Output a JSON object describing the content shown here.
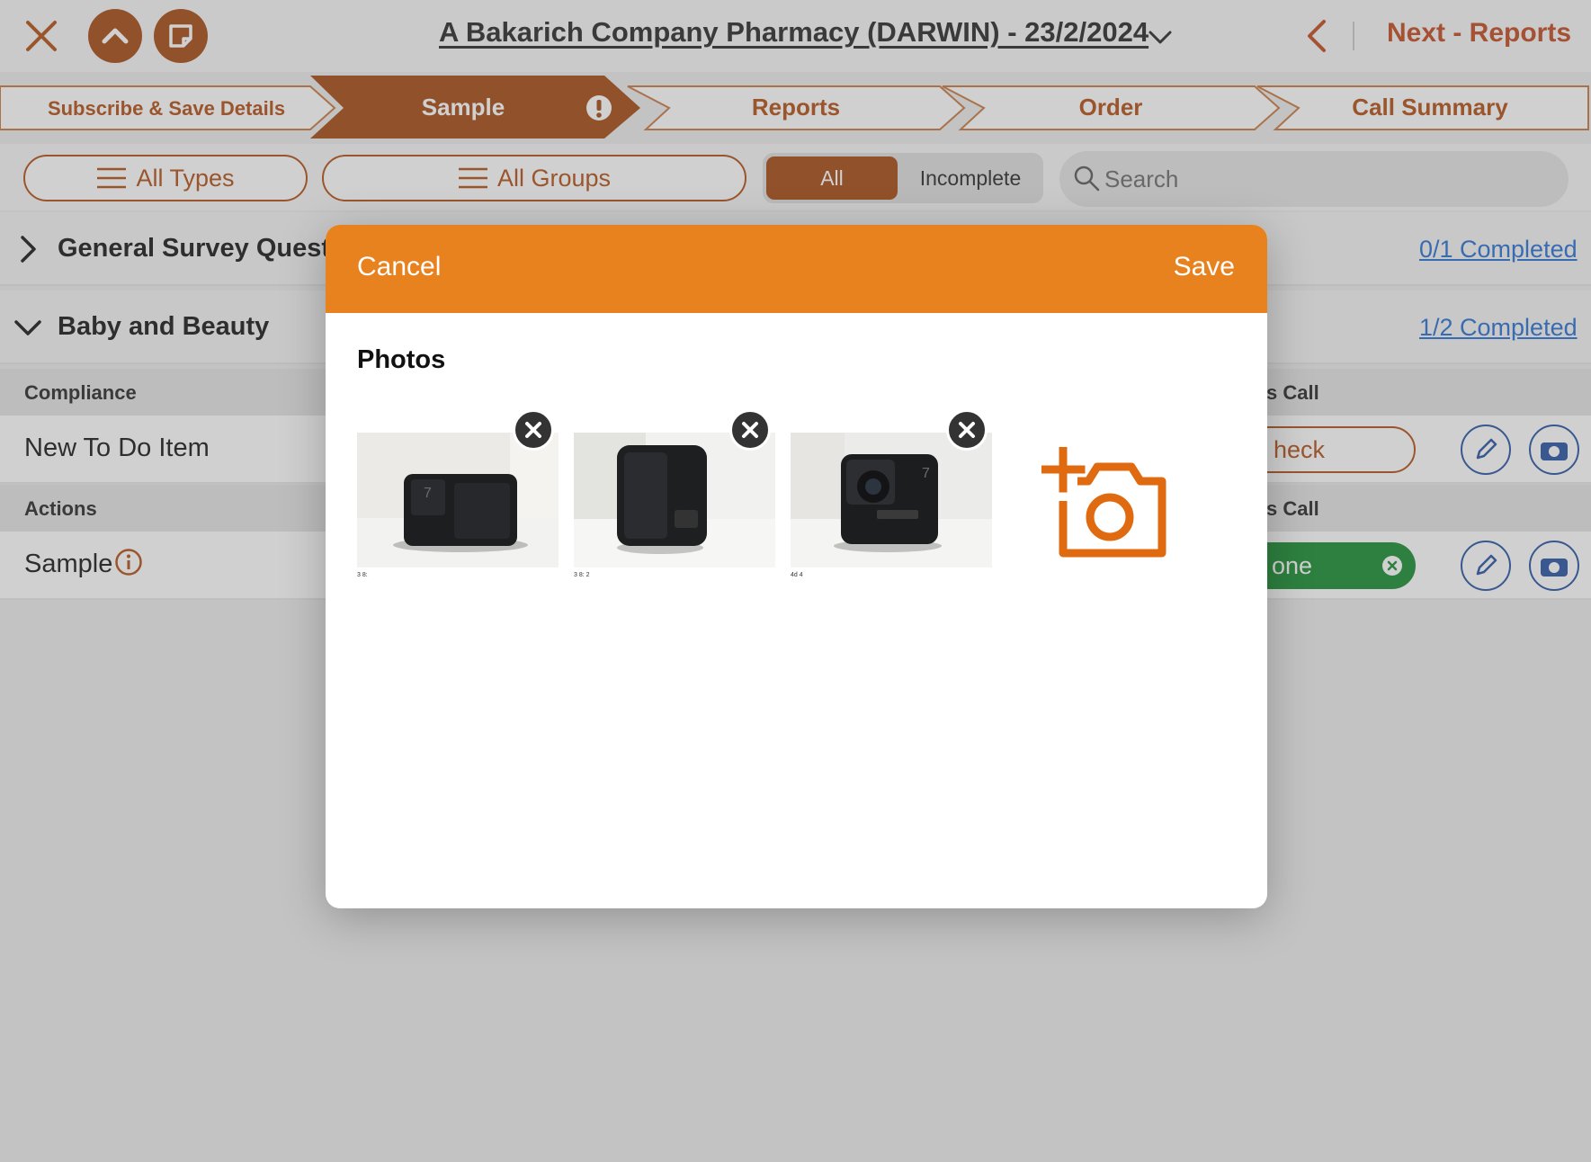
{
  "header": {
    "title": "A Bakarich Company Pharmacy (DARWIN) - 23/2/2024",
    "next_label": "Next - Reports"
  },
  "stepper": {
    "steps": [
      {
        "label": "Subscribe & Save Details",
        "active": false
      },
      {
        "label": "Sample",
        "active": true
      },
      {
        "label": "Reports",
        "active": false
      },
      {
        "label": "Order",
        "active": false
      },
      {
        "label": "Call Summary",
        "active": false
      }
    ]
  },
  "filters": {
    "types_label": "All Types",
    "groups_label": "All Groups",
    "segment": {
      "all": "All",
      "incomplete": "Incomplete",
      "selected": "All"
    },
    "search_placeholder": "Search"
  },
  "sections": [
    {
      "title": "General Survey Questi",
      "progress": "0/1 Completed",
      "expanded": false
    },
    {
      "title": "Baby and Beauty",
      "progress": "1/2 Completed",
      "expanded": true
    }
  ],
  "subsections": [
    {
      "title": "Compliance",
      "right": "s Call"
    },
    {
      "title": "Actions",
      "right": "s Call"
    }
  ],
  "rows": [
    {
      "title": "New To Do Item",
      "status": "heck"
    },
    {
      "title": "Sample",
      "status": "one"
    }
  ],
  "modal": {
    "cancel_label": "Cancel",
    "save_label": "Save",
    "photos_title": "Photos",
    "photos": [
      {
        "caption": "3 8:"
      },
      {
        "caption": "3 8: 2"
      },
      {
        "caption": "4d 4"
      }
    ]
  },
  "colors": {
    "brand": "#a3440b",
    "accent": "#e8821f",
    "link": "#1f6bd1",
    "done": "#0f8a2a"
  }
}
